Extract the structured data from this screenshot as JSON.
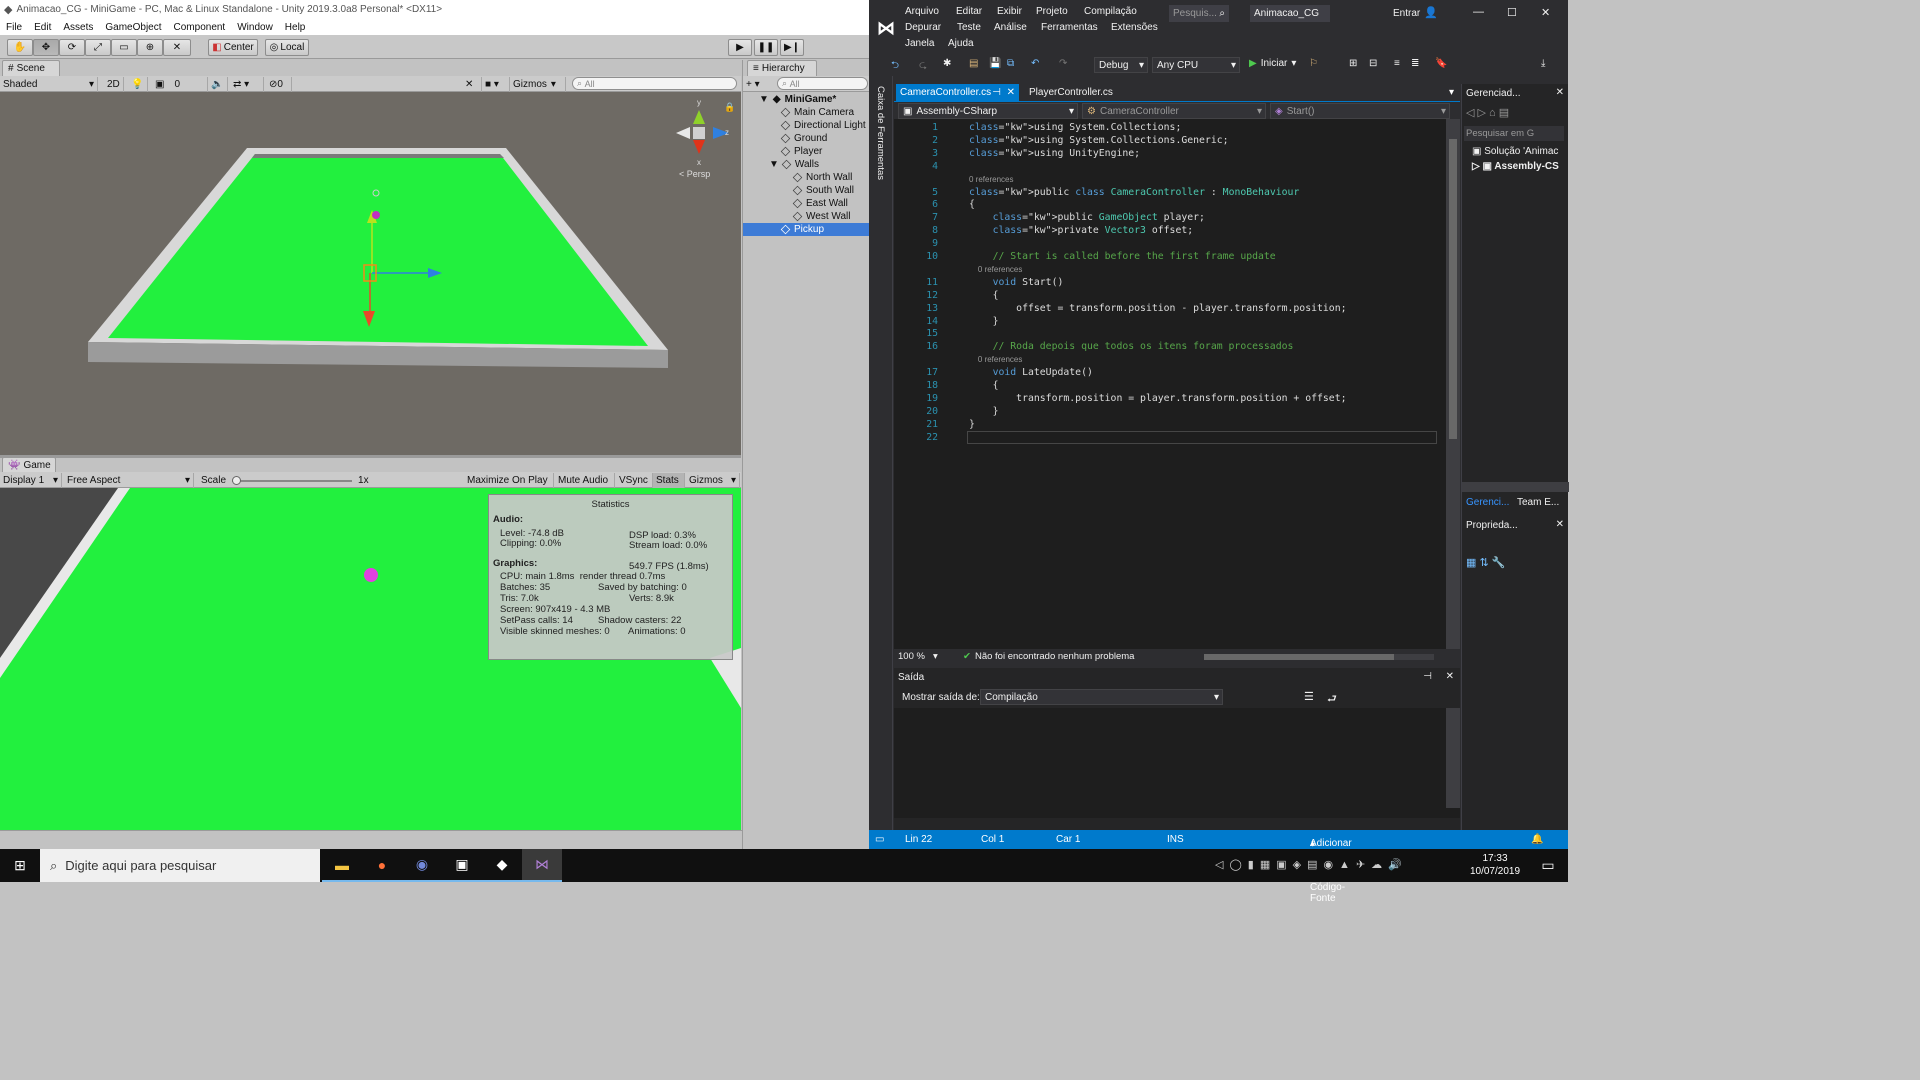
{
  "unity": {
    "title": "Animacao_CG - MiniGame - PC, Mac & Linux Standalone - Unity 2019.3.0a8 Personal* <DX11>",
    "menu": [
      "File",
      "Edit",
      "Assets",
      "GameObject",
      "Component",
      "Window",
      "Help"
    ],
    "toolbar": {
      "pivot": "Center",
      "space": "Local"
    },
    "scene": {
      "tab": "Scene",
      "shading": "Shaded",
      "mode_2d": "2D",
      "effects_count": "0",
      "hidden_count": "0",
      "gizmos": "Gizmos",
      "search_placeholder": "All",
      "persp_label": "< Persp"
    },
    "game": {
      "tab": "Game",
      "display": "Display 1",
      "aspect": "Free Aspect",
      "scale_label": "Scale",
      "scale_value": 1,
      "scale_value_text": "1x",
      "maximize": "Maximize On Play",
      "mute": "Mute Audio",
      "vsync": "VSync",
      "stats": "Stats",
      "gizmos": "Gizmos"
    },
    "hierarchy": {
      "tab": "Hierarchy",
      "search_placeholder": "All",
      "scene": "MiniGame*",
      "items": [
        "Main Camera",
        "Directional Light",
        "Ground",
        "Player",
        "Walls",
        "North Wall",
        "South Wall",
        "East Wall",
        "West Wall",
        "Pickup"
      ],
      "selected": "Pickup"
    },
    "stats": {
      "title": "Statistics",
      "audio_heading": "Audio:",
      "level": "Level: -74.8 dB",
      "clipping": "Clipping: 0.0%",
      "dsp": "DSP load: 0.3%",
      "stream": "Stream load: 0.0%",
      "graphics_heading": "Graphics:",
      "fps": "549.7 FPS (1.8ms)",
      "cpu": "CPU: main 1.8ms  render thread 0.7ms",
      "batches": "Batches: 35",
      "saved": "Saved by batching: 0",
      "tris": "Tris: 7.0k",
      "verts": "Verts: 8.9k",
      "screen": "Screen: 907x419 - 4.3 MB",
      "setpass": "SetPass calls: 14",
      "shadow": "Shadow casters: 22",
      "skinned": "Visible skinned meshes: 0",
      "animations": "Animations: 0"
    },
    "colors": {
      "ground": "#22f03e",
      "wall": "#e8e8e8",
      "pickup": "#e040e0",
      "selection": "#3d7bd6"
    }
  },
  "vs": {
    "menu_row1": [
      "Arquivo",
      "Editar",
      "Exibir",
      "Projeto",
      "Compilação"
    ],
    "menu_row2": [
      "Depurar",
      "Teste",
      "Análise",
      "Ferramentas",
      "Extensões"
    ],
    "menu_row3": [
      "Janela",
      "Ajuda"
    ],
    "search_placeholder": "Pesquis...",
    "solution_name": "Animacao_CG",
    "signin": "Entrar",
    "config": "Debug",
    "platform": "Any CPU",
    "start": "Iniciar",
    "toolbox_label": "Caixa de Ferramentas",
    "tabs": [
      "CameraController.cs",
      "PlayerController.cs"
    ],
    "nav": {
      "project": "Assembly-CSharp",
      "class": "CameraController",
      "member": "Start()"
    },
    "code": [
      {
        "n": "1",
        "t": "using System.Collections;"
      },
      {
        "n": "2",
        "t": "using System.Collections.Generic;"
      },
      {
        "n": "3",
        "t": "using UnityEngine;"
      },
      {
        "n": "4",
        "t": ""
      },
      {
        "n": "",
        "t": "0 references"
      },
      {
        "n": "5",
        "t": "public class CameraController : MonoBehaviour"
      },
      {
        "n": "6",
        "t": "{"
      },
      {
        "n": "7",
        "t": "    public GameObject player;"
      },
      {
        "n": "8",
        "t": "    private Vector3 offset;"
      },
      {
        "n": "9",
        "t": ""
      },
      {
        "n": "10",
        "t": "    // Start is called before the first frame update"
      },
      {
        "n": "",
        "t": "    0 references"
      },
      {
        "n": "11",
        "t": "    void Start()"
      },
      {
        "n": "12",
        "t": "    {"
      },
      {
        "n": "13",
        "t": "        offset = transform.position - player.transform.position;"
      },
      {
        "n": "14",
        "t": "    }"
      },
      {
        "n": "15",
        "t": ""
      },
      {
        "n": "16",
        "t": "    // Roda depois que todos os itens foram processados"
      },
      {
        "n": "",
        "t": "    0 references"
      },
      {
        "n": "17",
        "t": "    void LateUpdate()"
      },
      {
        "n": "18",
        "t": "    {"
      },
      {
        "n": "19",
        "t": "        transform.position = player.transform.position + offset;"
      },
      {
        "n": "20",
        "t": "    }"
      },
      {
        "n": "21",
        "t": "}"
      },
      {
        "n": "22",
        "t": ""
      }
    ],
    "zoom": "100 %",
    "issues": "Não foi encontrado nenhum problema",
    "output": {
      "title": "Saída",
      "show_label": "Mostrar saída de:",
      "source": "Compilação"
    },
    "solution_explorer": {
      "title": "Gerenciad...",
      "search": "Pesquisar em G",
      "solution": "Solução 'Animac",
      "project": "Assembly-CS",
      "tab1": "Gerenci...",
      "tab2": "Team E..."
    },
    "properties": {
      "title": "Proprieda..."
    },
    "status": {
      "line": "Lin 22",
      "col": "Col 1",
      "car": "Car 1",
      "ins": "INS",
      "source_control": "Adicionar ao Controle do Código-Fonte"
    }
  },
  "taskbar": {
    "search_placeholder": "Digite aqui para pesquisar",
    "time": "17:33",
    "date": "10/07/2019"
  }
}
